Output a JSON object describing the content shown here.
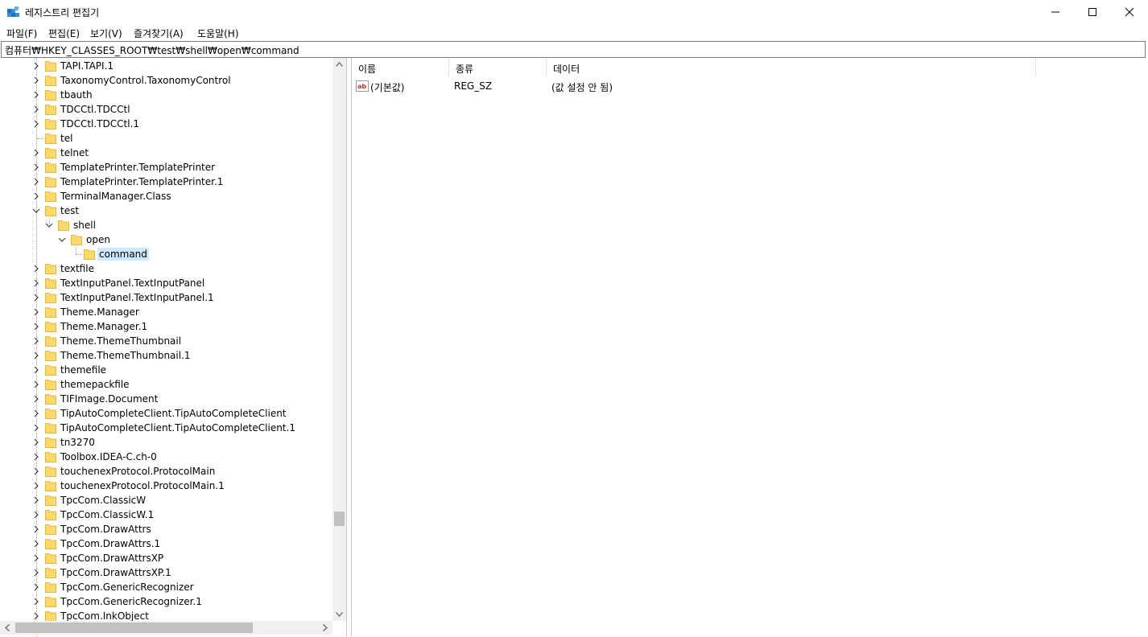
{
  "window": {
    "title": "레지스트리 편집기",
    "icons": [
      "registry-editor-icon",
      "minimize-icon",
      "maximize-icon",
      "close-icon"
    ]
  },
  "menu": [
    "파일(F)",
    "편집(E)",
    "보기(V)",
    "즐겨찾기(A)",
    "도움말(H)"
  ],
  "address": "컴퓨터₩HKEY_CLASSES_ROOT₩test₩shell₩open₩command",
  "tree": {
    "items": [
      {
        "label": "TAPI.TAPI.1",
        "depth": 0,
        "expander": "collapsed"
      },
      {
        "label": "TaxonomyControl.TaxonomyControl",
        "depth": 0,
        "expander": "collapsed"
      },
      {
        "label": "tbauth",
        "depth": 0,
        "expander": "collapsed"
      },
      {
        "label": "TDCCtl.TDCCtl",
        "depth": 0,
        "expander": "collapsed"
      },
      {
        "label": "TDCCtl.TDCCtl.1",
        "depth": 0,
        "expander": "collapsed"
      },
      {
        "label": "tel",
        "depth": 0,
        "expander": "none"
      },
      {
        "label": "telnet",
        "depth": 0,
        "expander": "collapsed"
      },
      {
        "label": "TemplatePrinter.TemplatePrinter",
        "depth": 0,
        "expander": "collapsed"
      },
      {
        "label": "TemplatePrinter.TemplatePrinter.1",
        "depth": 0,
        "expander": "collapsed"
      },
      {
        "label": "TerminalManager.Class",
        "depth": 0,
        "expander": "collapsed"
      },
      {
        "label": "test",
        "depth": 0,
        "expander": "expanded"
      },
      {
        "label": "shell",
        "depth": 1,
        "expander": "expanded"
      },
      {
        "label": "open",
        "depth": 2,
        "expander": "expanded"
      },
      {
        "label": "command",
        "depth": 3,
        "expander": "none",
        "selected": true
      },
      {
        "label": "textfile",
        "depth": 0,
        "expander": "collapsed"
      },
      {
        "label": "TextInputPanel.TextInputPanel",
        "depth": 0,
        "expander": "collapsed"
      },
      {
        "label": "TextInputPanel.TextInputPanel.1",
        "depth": 0,
        "expander": "collapsed"
      },
      {
        "label": "Theme.Manager",
        "depth": 0,
        "expander": "collapsed"
      },
      {
        "label": "Theme.Manager.1",
        "depth": 0,
        "expander": "collapsed"
      },
      {
        "label": "Theme.ThemeThumbnail",
        "depth": 0,
        "expander": "collapsed"
      },
      {
        "label": "Theme.ThemeThumbnail.1",
        "depth": 0,
        "expander": "collapsed"
      },
      {
        "label": "themefile",
        "depth": 0,
        "expander": "collapsed"
      },
      {
        "label": "themepackfile",
        "depth": 0,
        "expander": "collapsed"
      },
      {
        "label": "TIFImage.Document",
        "depth": 0,
        "expander": "collapsed"
      },
      {
        "label": "TipAutoCompleteClient.TipAutoCompleteClient",
        "depth": 0,
        "expander": "collapsed"
      },
      {
        "label": "TipAutoCompleteClient.TipAutoCompleteClient.1",
        "depth": 0,
        "expander": "collapsed"
      },
      {
        "label": "tn3270",
        "depth": 0,
        "expander": "collapsed"
      },
      {
        "label": "Toolbox.IDEA-C.ch-0",
        "depth": 0,
        "expander": "collapsed"
      },
      {
        "label": "touchenexProtocol.ProtocolMain",
        "depth": 0,
        "expander": "collapsed"
      },
      {
        "label": "touchenexProtocol.ProtocolMain.1",
        "depth": 0,
        "expander": "collapsed"
      },
      {
        "label": "TpcCom.ClassicW",
        "depth": 0,
        "expander": "collapsed"
      },
      {
        "label": "TpcCom.ClassicW.1",
        "depth": 0,
        "expander": "collapsed"
      },
      {
        "label": "TpcCom.DrawAttrs",
        "depth": 0,
        "expander": "collapsed"
      },
      {
        "label": "TpcCom.DrawAttrs.1",
        "depth": 0,
        "expander": "collapsed"
      },
      {
        "label": "TpcCom.DrawAttrsXP",
        "depth": 0,
        "expander": "collapsed"
      },
      {
        "label": "TpcCom.DrawAttrsXP.1",
        "depth": 0,
        "expander": "collapsed"
      },
      {
        "label": "TpcCom.GenericRecognizer",
        "depth": 0,
        "expander": "collapsed"
      },
      {
        "label": "TpcCom.GenericRecognizer.1",
        "depth": 0,
        "expander": "collapsed"
      },
      {
        "label": "TpcCom.InkObject",
        "depth": 0,
        "expander": "collapsed"
      }
    ],
    "folder_color": "#ffd966",
    "selection_color": "#cce8ff"
  },
  "list": {
    "columns": [
      "이름",
      "종류",
      "데이터"
    ],
    "rows": [
      {
        "icon": "string-value-icon",
        "name": "(기본값)",
        "type": "REG_SZ",
        "data": "(값 설정 안 됨)"
      }
    ]
  }
}
